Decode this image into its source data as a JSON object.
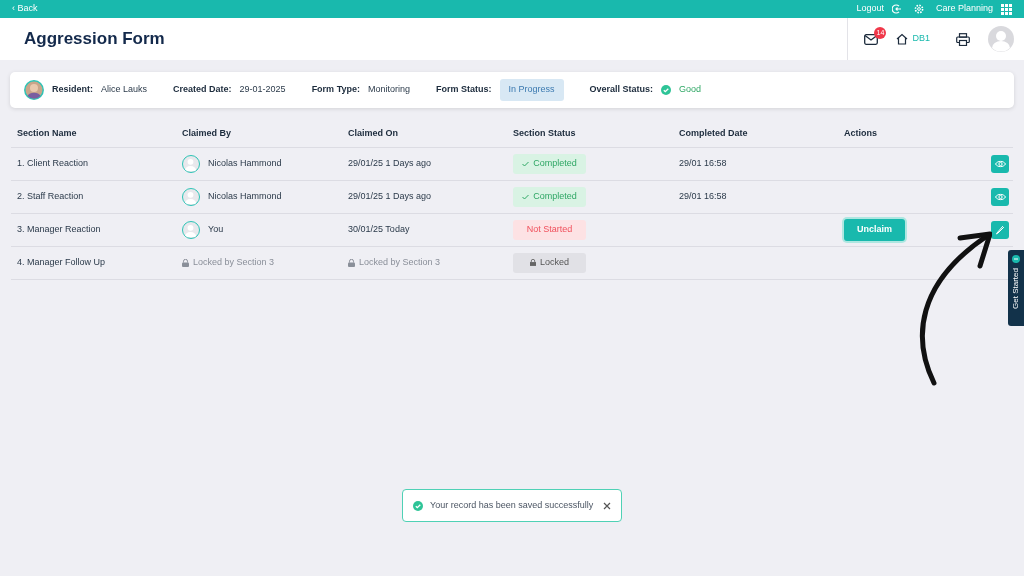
{
  "top_bar": {
    "back": "‹ Back",
    "logout": "Logout",
    "app": "Care Planning"
  },
  "header": {
    "title": "Aggression Form",
    "mail_count": "14",
    "home_label": "DB1"
  },
  "summary": [
    {
      "label": "Resident:",
      "value": "Alice Lauks",
      "kind": "avatar"
    },
    {
      "label": "Created Date:",
      "value": "29-01-2025",
      "kind": "text"
    },
    {
      "label": "Form Type:",
      "value": "Monitoring",
      "kind": "text"
    },
    {
      "label": "Form Status:",
      "value": "In Progress",
      "kind": "pill"
    },
    {
      "label": "Overall Status:",
      "value": "Good",
      "kind": "check"
    }
  ],
  "table": {
    "columns": [
      "Section Name",
      "Claimed By",
      "Claimed On",
      "Section Status",
      "Completed Date",
      "Actions"
    ],
    "rows": [
      {
        "section_name": "1. Client Reaction",
        "claimed_by": {
          "text": "Nicolas Hammond",
          "locked": false
        },
        "claimed_on": {
          "text": "29/01/25 1 Days ago",
          "locked": false
        },
        "section_status": {
          "text": "Completed",
          "kind": "completed"
        },
        "completed_date": "29/01 16:58",
        "actions": [
          {
            "kind": "view"
          }
        ]
      },
      {
        "section_name": "2. Staff Reaction",
        "claimed_by": {
          "text": "Nicolas Hammond",
          "locked": false
        },
        "claimed_on": {
          "text": "29/01/25 1 Days ago",
          "locked": false
        },
        "section_status": {
          "text": "Completed",
          "kind": "completed"
        },
        "completed_date": "29/01 16:58",
        "actions": [
          {
            "kind": "view"
          }
        ]
      },
      {
        "section_name": "3. Manager Reaction",
        "claimed_by": {
          "text": "You",
          "locked": false
        },
        "claimed_on": {
          "text": "30/01/25 Today",
          "locked": false
        },
        "section_status": {
          "text": "Not Started",
          "kind": "not_started"
        },
        "actions": [
          {
            "kind": "unclaim",
            "label": "Unclaim"
          },
          {
            "kind": "edit"
          }
        ]
      },
      {
        "section_name": "4. Manager Follow Up",
        "claimed_by": {
          "text": "Locked by Section 3",
          "locked": true
        },
        "claimed_on": {
          "text": "Locked by Section 3",
          "locked": true
        },
        "section_status": {
          "text": "Locked",
          "kind": "locked"
        }
      }
    ]
  },
  "side_tab": {
    "label": "Get Started"
  },
  "toast": {
    "message": "Your record has been saved successfully"
  }
}
